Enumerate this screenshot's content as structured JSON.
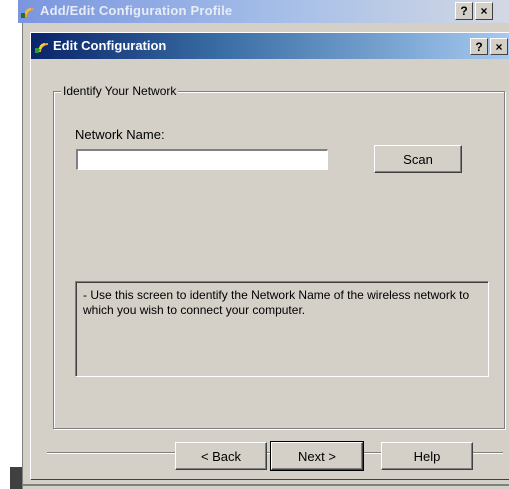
{
  "background_window": {
    "title": "Add/Edit Configuration Profile",
    "controls": {
      "help": "?",
      "close": "×"
    }
  },
  "dialog": {
    "title": "Edit Configuration",
    "title_icon": "wireless-signal-icon",
    "controls": {
      "help": "?",
      "close": "×"
    }
  },
  "group": {
    "label": "Identify Your Network",
    "network_name_label": "Network Name:",
    "network_name_value": "",
    "scan_label": "Scan"
  },
  "info": {
    "text": "- Use this screen to identify the Network Name of the wireless network to which you wish to connect your computer."
  },
  "footer": {
    "back_label": "< Back",
    "next_label": "Next >",
    "help_label": "Help"
  }
}
